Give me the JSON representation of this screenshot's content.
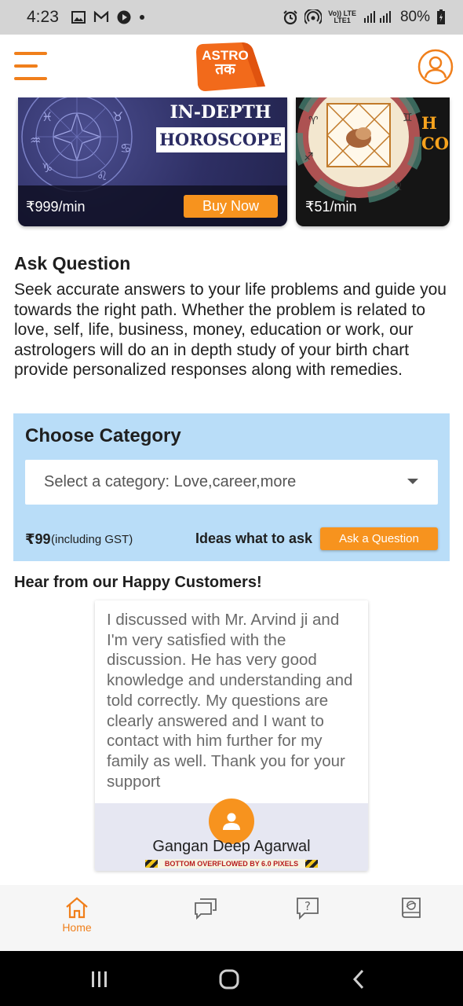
{
  "status_bar": {
    "time": "4:23",
    "network_label": "Vo)) LTE",
    "network_sub": "LTE1",
    "battery": "80%"
  },
  "header": {
    "logo_line1": "ASTRO",
    "logo_line2": "तक"
  },
  "banners": [
    {
      "heading_top": "IN-DEPTH",
      "heading_main": "HOROSCOPE",
      "price": "₹999/min",
      "button": "Buy Now"
    },
    {
      "heading_partial": "H\nCO",
      "price": "₹51/min"
    }
  ],
  "ask_question": {
    "title": "Ask Question",
    "description": "Seek accurate answers to your life problems and guide you towards the right path. Whether the problem is related to love, self, life, business, money, education or work, our astrologers will do an in depth study of your birth chart provide personalized responses along with remedies."
  },
  "category": {
    "title": "Choose Category",
    "placeholder": "Select a category: Love,career,more",
    "price": "₹99",
    "price_note": "(including GST)",
    "ideas_label": "Ideas what to ask",
    "ask_button": "Ask a Question"
  },
  "testimonials": {
    "title": "Hear from our Happy Customers!",
    "items": [
      {
        "text": "I discussed with Mr. Arvind ji and I'm very satisfied with the discussion. He has very good knowledge and understanding and told correctly. My questions are clearly answered and I want to contact with him further for my family as well. Thank you for your support",
        "name": "Gangan Deep Agarwal"
      }
    ],
    "overflow_warning": "BOTTOM OVERFLOWED BY 6.0 PIXELS"
  },
  "bottom_nav": {
    "items": [
      {
        "label": "Home",
        "icon": "home-icon",
        "active": true
      },
      {
        "label": "",
        "icon": "chat-icon",
        "active": false
      },
      {
        "label": "",
        "icon": "question-icon",
        "active": false
      },
      {
        "label": "",
        "icon": "book-icon",
        "active": false
      }
    ]
  },
  "colors": {
    "accent": "#f7931e",
    "category_bg": "#b9ddf8",
    "banner_bg": "#2e2f64"
  }
}
